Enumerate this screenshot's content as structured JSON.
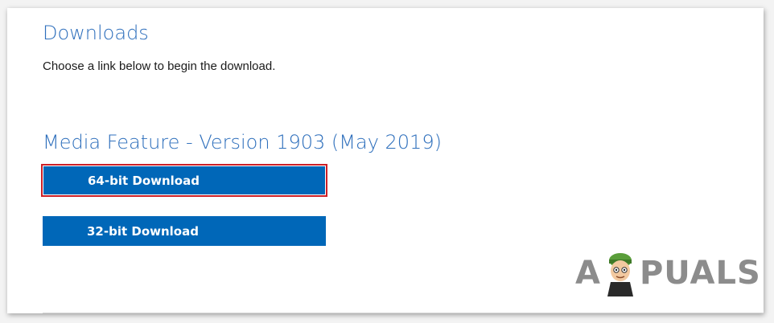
{
  "downloads": {
    "title": "Downloads",
    "intro": "Choose a link below to begin the download."
  },
  "media_feature": {
    "title": "Media Feature - Version 1903 (May 2019)",
    "buttons": [
      {
        "label": "64-bit Download",
        "highlighted": true
      },
      {
        "label": "32-bit Download",
        "highlighted": false
      }
    ]
  },
  "watermark": {
    "text_left": "A",
    "text_right": "PUALS"
  },
  "colors": {
    "heading": "#2e6fbc",
    "button_bg": "#0067b8",
    "highlight": "#cc2027"
  }
}
